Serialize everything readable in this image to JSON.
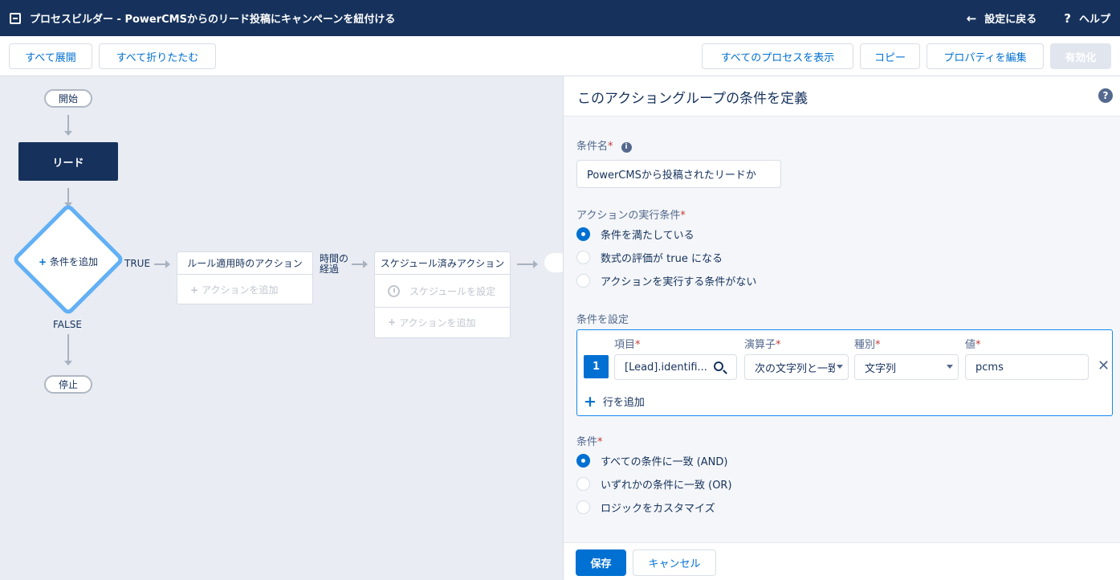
{
  "header": {
    "title": "プロセスビルダー - PowerCMSからのリード投稿にキャンペーンを紐付ける",
    "back_label": "設定に戻る",
    "help_label": "ヘルプ"
  },
  "toolbar": {
    "expand_all": "すべて展開",
    "collapse_all": "すべて折りたたむ",
    "show_all_processes": "すべてのプロセスを表示",
    "copy": "コピー",
    "edit_properties": "プロパティを編集",
    "activate": "有効化"
  },
  "canvas": {
    "start": "開始",
    "object": "リード",
    "add_criteria": "条件を追加",
    "true_label": "TRUE",
    "false_label": "FALSE",
    "stop": "停止",
    "immediate_actions": "ルール適用時のアクション",
    "add_action": "アクションを追加",
    "time_elapsed_line1": "時間の",
    "time_elapsed_line2": "経過",
    "scheduled_actions": "スケジュール済みアクション",
    "set_schedule": "スケジュールを設定",
    "add_action_2": "アクションを追加"
  },
  "panel": {
    "title": "このアクショングループの条件を定義",
    "criteria_name_label": "条件名",
    "criteria_name_value": "PowerCMSから投稿されたリードか",
    "execution_label": "アクションの実行条件",
    "execution_options": [
      {
        "label": "条件を満たしている",
        "selected": true
      },
      {
        "label": "数式の評価が true になる",
        "selected": false
      },
      {
        "label": "アクションを実行する条件がない",
        "selected": false
      }
    ],
    "set_conditions_label": "条件を設定",
    "columns": {
      "field": "項目",
      "operator": "演算子",
      "type": "種別",
      "value": "値"
    },
    "row": {
      "number": "1",
      "field": "[Lead].identifi...",
      "operator": "次の文字列と一致",
      "type": "文字列",
      "value": "pcms"
    },
    "add_row": "行を追加",
    "conditions_label": "条件",
    "logic_options": [
      {
        "label": "すべての条件に一致 (AND)",
        "selected": true
      },
      {
        "label": "いずれかの条件に一致 (OR)",
        "selected": false
      },
      {
        "label": "ロジックをカスタマイズ",
        "selected": false
      }
    ],
    "save": "保存",
    "cancel": "キャンセル"
  }
}
